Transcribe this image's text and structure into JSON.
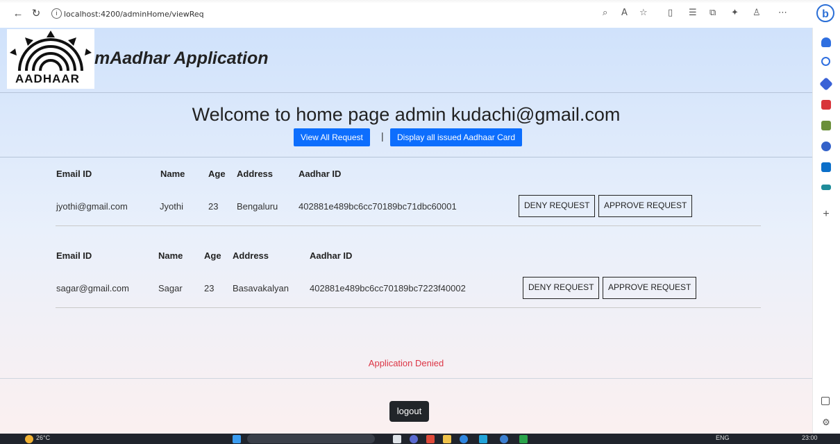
{
  "browser": {
    "url": "localhost:4200/adminHome/viewReq"
  },
  "header": {
    "logo_text": "AADHAAR",
    "app_title": "mAadhar Application"
  },
  "welcome": {
    "heading": "Welcome to home page admin kudachi@gmail.com",
    "view_all_button": "View All Request",
    "separator": "|",
    "display_issued_button": "Display all issued Aadhaar Card"
  },
  "table": {
    "columns": [
      "Email ID",
      "Name",
      "Age",
      "Address",
      "Aadhar ID"
    ],
    "rows": [
      {
        "email": "jyothi@gmail.com",
        "name": "Jyothi",
        "age": "23",
        "address": "Bengaluru",
        "aadhar_id": "402881e489bc6cc70189bc71dbc60001",
        "deny_label": "DENY REQUEST",
        "approve_label": "APPROVE REQUEST"
      },
      {
        "email": "sagar@gmail.com",
        "name": "Sagar",
        "age": "23",
        "address": "Basavakalyan",
        "aadhar_id": "402881e489bc6cc70189bc7223f40002",
        "deny_label": "DENY REQUEST",
        "approve_label": "APPROVE REQUEST"
      }
    ]
  },
  "status_message": "Application Denied",
  "logout_label": "logout",
  "taskbar": {
    "weather": "26°C",
    "lang": "ENG",
    "time": "23:00"
  },
  "colors": {
    "primary_button": "#0d6efd",
    "status_error": "#dc3545",
    "logout_bg": "#212529"
  }
}
